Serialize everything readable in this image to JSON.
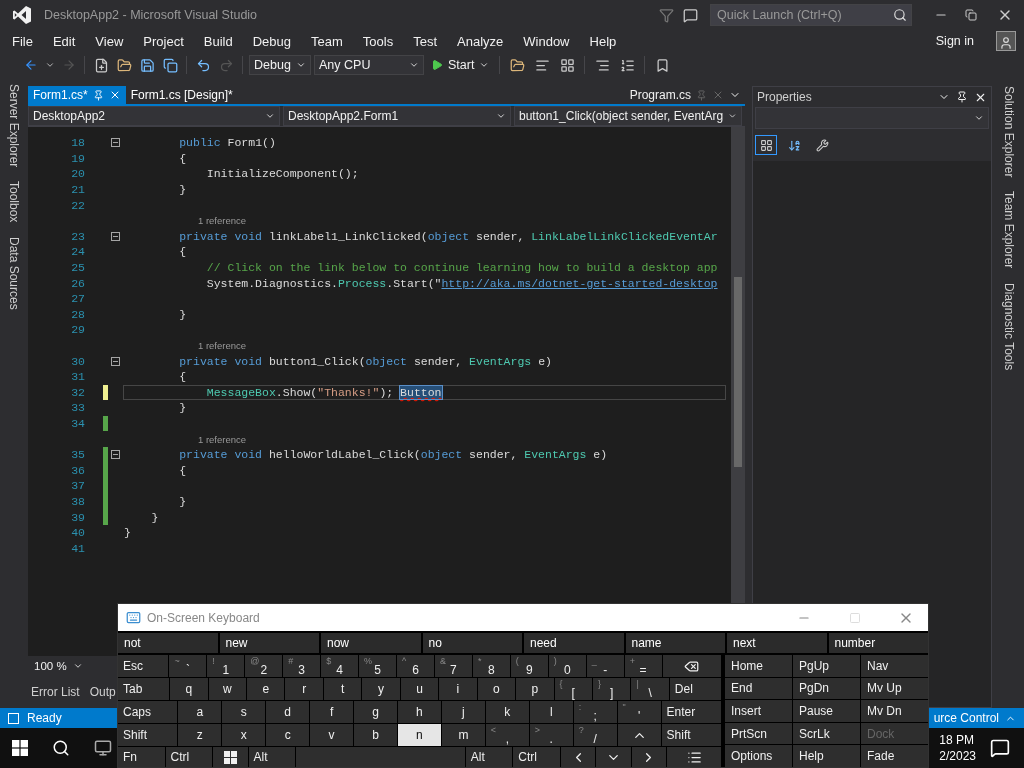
{
  "window": {
    "title": "DesktopApp2 - Microsoft Visual Studio"
  },
  "quick_launch": {
    "placeholder": "Quick Launch (Ctrl+Q)"
  },
  "menu": [
    "File",
    "Edit",
    "View",
    "Project",
    "Build",
    "Debug",
    "Team",
    "Tools",
    "Test",
    "Analyze",
    "Window",
    "Help"
  ],
  "sign_in": "Sign in",
  "toolbar": {
    "configuration": "Debug",
    "platform": "Any CPU",
    "start": "Start"
  },
  "left_tool_tabs": [
    "Server Explorer",
    "Toolbox",
    "Data Sources"
  ],
  "editor": {
    "tabs": [
      {
        "label": "Form1.cs*",
        "selected": true
      },
      {
        "label": "Form1.cs [Design]*",
        "selected": false
      }
    ],
    "preview_tab": "Program.cs",
    "nav": [
      "DesktopApp2",
      "DesktopApp2.Form1",
      "button1_Click(object sender, EventArg"
    ],
    "lines": [
      {
        "kind": "code",
        "number": "18",
        "fold": true,
        "unsaved": false,
        "saved": false,
        "current": false,
        "tokens": [
          {
            "kind": "keyword",
            "text": "        public "
          },
          {
            "kind": "plain",
            "text": "Form1()"
          }
        ]
      },
      {
        "kind": "code",
        "number": "19",
        "fold": false,
        "unsaved": false,
        "saved": false,
        "current": false,
        "tokens": [
          {
            "kind": "plain",
            "text": "        {"
          }
        ]
      },
      {
        "kind": "code",
        "number": "20",
        "fold": false,
        "unsaved": false,
        "saved": false,
        "current": false,
        "tokens": [
          {
            "kind": "plain",
            "text": "            InitializeComponent();"
          }
        ]
      },
      {
        "kind": "code",
        "number": "21",
        "fold": false,
        "unsaved": false,
        "saved": false,
        "current": false,
        "tokens": [
          {
            "kind": "plain",
            "text": "        }"
          }
        ]
      },
      {
        "kind": "code",
        "number": "22",
        "fold": false,
        "unsaved": false,
        "saved": false,
        "current": false
      },
      {
        "kind": "reference",
        "text": "1 reference"
      },
      {
        "kind": "code",
        "number": "23",
        "fold": true,
        "unsaved": false,
        "saved": false,
        "current": false,
        "tokens": [
          {
            "kind": "keyword",
            "text": "        private void "
          },
          {
            "kind": "plain",
            "text": "linkLabel1_LinkClicked("
          },
          {
            "kind": "keyword",
            "text": "object"
          },
          {
            "kind": "plain",
            "text": " sender, "
          },
          {
            "kind": "type",
            "text": "LinkLabelLinkClickedEventAr"
          }
        ]
      },
      {
        "kind": "code",
        "number": "24",
        "fold": false,
        "unsaved": false,
        "saved": false,
        "current": false,
        "tokens": [
          {
            "kind": "plain",
            "text": "        {"
          }
        ]
      },
      {
        "kind": "code",
        "number": "25",
        "fold": false,
        "unsaved": false,
        "saved": false,
        "current": false,
        "tokens": [
          {
            "kind": "comment",
            "text": "            // Click on the link below to continue learning how to build a desktop app"
          }
        ]
      },
      {
        "kind": "code",
        "number": "26",
        "fold": false,
        "unsaved": false,
        "saved": false,
        "current": false,
        "tokens": [
          {
            "kind": "plain",
            "text": "            System.Diagnostics."
          },
          {
            "kind": "type",
            "text": "Process"
          },
          {
            "kind": "plain",
            "text": ".Start(\""
          },
          {
            "kind": "link",
            "text": "http://aka.ms/dotnet-get-started-desktop"
          }
        ]
      },
      {
        "kind": "code",
        "number": "27",
        "fold": false,
        "unsaved": false,
        "saved": false,
        "current": false
      },
      {
        "kind": "code",
        "number": "28",
        "fold": false,
        "unsaved": false,
        "saved": false,
        "current": false,
        "tokens": [
          {
            "kind": "plain",
            "text": "        }"
          }
        ]
      },
      {
        "kind": "code",
        "number": "29",
        "fold": false,
        "unsaved": false,
        "saved": false,
        "current": false
      },
      {
        "kind": "reference",
        "text": "1 reference"
      },
      {
        "kind": "code",
        "number": "30",
        "fold": true,
        "unsaved": false,
        "saved": false,
        "current": false,
        "tokens": [
          {
            "kind": "keyword",
            "text": "        private void "
          },
          {
            "kind": "plain",
            "text": "button1_Click("
          },
          {
            "kind": "keyword",
            "text": "object"
          },
          {
            "kind": "plain",
            "text": " sender, "
          },
          {
            "kind": "type",
            "text": "EventArgs"
          },
          {
            "kind": "plain",
            "text": " e)"
          }
        ]
      },
      {
        "kind": "code",
        "number": "31",
        "fold": false,
        "unsaved": false,
        "saved": false,
        "current": false,
        "tokens": [
          {
            "kind": "plain",
            "text": "        {"
          }
        ]
      },
      {
        "kind": "code",
        "number": "32",
        "fold": false,
        "unsaved": true,
        "saved": false,
        "current": true,
        "tokens": [
          {
            "kind": "type",
            "text": "            MessageBox"
          },
          {
            "kind": "plain",
            "text": ".Show("
          },
          {
            "kind": "string",
            "text": "\"Thanks!\""
          },
          {
            "kind": "plain",
            "text": "); "
          },
          {
            "kind": "error",
            "text": "Button"
          }
        ]
      },
      {
        "kind": "code",
        "number": "33",
        "fold": false,
        "unsaved": false,
        "saved": false,
        "current": false,
        "tokens": [
          {
            "kind": "plain",
            "text": "        }"
          }
        ]
      },
      {
        "kind": "code",
        "number": "34",
        "fold": false,
        "unsaved": false,
        "saved": true,
        "current": false
      },
      {
        "kind": "reference",
        "text": "1 reference"
      },
      {
        "kind": "code",
        "number": "35",
        "fold": true,
        "unsaved": false,
        "saved": true,
        "current": false,
        "tokens": [
          {
            "kind": "keyword",
            "text": "        private void "
          },
          {
            "kind": "plain",
            "text": "helloWorldLabel_Click("
          },
          {
            "kind": "keyword",
            "text": "object"
          },
          {
            "kind": "plain",
            "text": " sender, "
          },
          {
            "kind": "type",
            "text": "EventArgs"
          },
          {
            "kind": "plain",
            "text": " e)"
          }
        ]
      },
      {
        "kind": "code",
        "number": "36",
        "fold": false,
        "unsaved": false,
        "saved": true,
        "current": false,
        "tokens": [
          {
            "kind": "plain",
            "text": "        {"
          }
        ]
      },
      {
        "kind": "code",
        "number": "37",
        "fold": false,
        "unsaved": false,
        "saved": true,
        "current": false
      },
      {
        "kind": "code",
        "number": "38",
        "fold": false,
        "unsaved": false,
        "saved": true,
        "current": false,
        "tokens": [
          {
            "kind": "plain",
            "text": "        }"
          }
        ]
      },
      {
        "kind": "code",
        "number": "39",
        "fold": false,
        "unsaved": false,
        "saved": true,
        "current": false,
        "tokens": [
          {
            "kind": "plain",
            "text": "    }"
          }
        ]
      },
      {
        "kind": "code",
        "number": "40",
        "fold": false,
        "unsaved": false,
        "saved": false,
        "current": false,
        "tokens": [
          {
            "kind": "plain",
            "text": "}"
          }
        ]
      },
      {
        "kind": "code",
        "number": "41",
        "fold": false,
        "unsaved": false,
        "saved": false,
        "current": false
      }
    ],
    "zoom": "100 %"
  },
  "properties": {
    "title": "Properties"
  },
  "right_tool_tabs": [
    "Solution Explorer",
    "Team Explorer",
    "Diagnostic Tools"
  ],
  "bottom_tabs": [
    "Error List",
    "Outp"
  ],
  "status_bar": {
    "state": "Ready",
    "source_control": "urce Control"
  },
  "taskbar": {
    "time": "18 PM",
    "date": "2/2023"
  },
  "keyboard": {
    "title": "On-Screen Keyboard",
    "suggestions": [
      "not",
      "new",
      "now",
      "no",
      "need",
      "name",
      "next",
      "number"
    ],
    "rows": [
      [
        {
          "kind": "mod",
          "label": "Esc",
          "pressed": false
        },
        {
          "kind": "char",
          "label": "`",
          "shift": "~",
          "pressed": false
        },
        {
          "kind": "char",
          "label": "1",
          "shift": "!",
          "pressed": false
        },
        {
          "kind": "char",
          "label": "2",
          "shift": "@",
          "pressed": false
        },
        {
          "kind": "char",
          "label": "3",
          "shift": "#",
          "pressed": false
        },
        {
          "kind": "char",
          "label": "4",
          "shift": "$",
          "pressed": false
        },
        {
          "kind": "char",
          "label": "5",
          "shift": "%",
          "pressed": false
        },
        {
          "kind": "char",
          "label": "6",
          "shift": "^",
          "pressed": false
        },
        {
          "kind": "char",
          "label": "7",
          "shift": "&",
          "pressed": false
        },
        {
          "kind": "char",
          "label": "8",
          "shift": "*",
          "pressed": false
        },
        {
          "kind": "char",
          "label": "9",
          "shift": "(",
          "pressed": false
        },
        {
          "kind": "char",
          "label": "0",
          "shift": ")",
          "pressed": false
        },
        {
          "kind": "char",
          "label": "-",
          "shift": "_",
          "pressed": false
        },
        {
          "kind": "char",
          "label": "=",
          "shift": "+",
          "pressed": false
        },
        {
          "kind": "backspace",
          "pressed": false
        }
      ],
      [
        {
          "kind": "mod",
          "label": "Tab",
          "pressed": false
        },
        {
          "kind": "letter",
          "label": "q",
          "pressed": false
        },
        {
          "kind": "letter",
          "label": "w",
          "pressed": false
        },
        {
          "kind": "letter",
          "label": "e",
          "pressed": false
        },
        {
          "kind": "letter",
          "label": "r",
          "pressed": false
        },
        {
          "kind": "letter",
          "label": "t",
          "pressed": false
        },
        {
          "kind": "letter",
          "label": "y",
          "pressed": false
        },
        {
          "kind": "letter",
          "label": "u",
          "pressed": false
        },
        {
          "kind": "letter",
          "label": "i",
          "pressed": false
        },
        {
          "kind": "letter",
          "label": "o",
          "pressed": false
        },
        {
          "kind": "letter",
          "label": "p",
          "pressed": false
        },
        {
          "kind": "char",
          "label": "[",
          "shift": "{",
          "pressed": false
        },
        {
          "kind": "char",
          "label": "]",
          "shift": "}",
          "pressed": false
        },
        {
          "kind": "char",
          "label": "\\",
          "shift": "|",
          "pressed": false
        },
        {
          "kind": "mod",
          "label": "Del",
          "pressed": false
        }
      ],
      [
        {
          "kind": "mod",
          "label": "Caps",
          "pressed": false
        },
        {
          "kind": "letter",
          "label": "a",
          "pressed": false
        },
        {
          "kind": "letter",
          "label": "s",
          "pressed": false
        },
        {
          "kind": "letter",
          "label": "d",
          "pressed": false
        },
        {
          "kind": "letter",
          "label": "f",
          "pressed": false
        },
        {
          "kind": "letter",
          "label": "g",
          "pressed": false
        },
        {
          "kind": "letter",
          "label": "h",
          "pressed": false
        },
        {
          "kind": "letter",
          "label": "j",
          "pressed": false
        },
        {
          "kind": "letter",
          "label": "k",
          "pressed": false
        },
        {
          "kind": "letter",
          "label": "l",
          "pressed": false
        },
        {
          "kind": "char",
          "label": ";",
          "shift": ":",
          "pressed": false
        },
        {
          "kind": "char",
          "label": "'",
          "shift": "\"",
          "pressed": false
        },
        {
          "kind": "mod",
          "label": "Enter",
          "pressed": false
        }
      ],
      [
        {
          "kind": "mod",
          "label": "Shift",
          "pressed": false
        },
        {
          "kind": "letter",
          "label": "z",
          "pressed": false
        },
        {
          "kind": "letter",
          "label": "x",
          "pressed": false
        },
        {
          "kind": "letter",
          "label": "c",
          "pressed": false
        },
        {
          "kind": "letter",
          "label": "v",
          "pressed": false
        },
        {
          "kind": "letter",
          "label": "b",
          "pressed": false
        },
        {
          "kind": "letter",
          "label": "n",
          "pressed": true
        },
        {
          "kind": "letter",
          "label": "m",
          "pressed": false
        },
        {
          "kind": "char",
          "label": ",",
          "shift": "<",
          "pressed": false
        },
        {
          "kind": "char",
          "label": ".",
          "shift": ">",
          "pressed": false
        },
        {
          "kind": "char",
          "label": "/",
          "shift": "?",
          "pressed": false
        },
        {
          "kind": "up",
          "pressed": false
        },
        {
          "kind": "mod",
          "label": "Shift",
          "pressed": false
        }
      ],
      [
        {
          "kind": "mod",
          "label": "Fn",
          "pressed": false
        },
        {
          "kind": "mod",
          "label": "Ctrl",
          "pressed": false
        },
        {
          "kind": "windows",
          "pressed": false
        },
        {
          "kind": "mod",
          "label": "Alt",
          "pressed": false
        },
        {
          "kind": "space",
          "pressed": false
        },
        {
          "kind": "mod",
          "label": "Alt",
          "pressed": false
        },
        {
          "kind": "mod",
          "label": "Ctrl",
          "pressed": false
        },
        {
          "kind": "left",
          "pressed": false
        },
        {
          "kind": "down",
          "pressed": false
        },
        {
          "kind": "right",
          "pressed": false
        },
        {
          "kind": "menu",
          "pressed": false
        }
      ]
    ],
    "nav_keys": [
      {
        "label": "Home",
        "disabled": false
      },
      {
        "label": "PgUp",
        "disabled": false
      },
      {
        "label": "Nav",
        "disabled": false
      },
      {
        "label": "End",
        "disabled": false
      },
      {
        "label": "PgDn",
        "disabled": false
      },
      {
        "label": "Mv Up",
        "disabled": false
      },
      {
        "label": "Insert",
        "disabled": false
      },
      {
        "label": "Pause",
        "disabled": false
      },
      {
        "label": "Mv Dn",
        "disabled": false
      },
      {
        "label": "PrtScn",
        "disabled": false
      },
      {
        "label": "ScrLk",
        "disabled": false
      },
      {
        "label": "Dock",
        "disabled": true
      },
      {
        "label": "Options",
        "disabled": false
      },
      {
        "label": "Help",
        "disabled": false
      },
      {
        "label": "Fade",
        "disabled": false
      }
    ]
  }
}
